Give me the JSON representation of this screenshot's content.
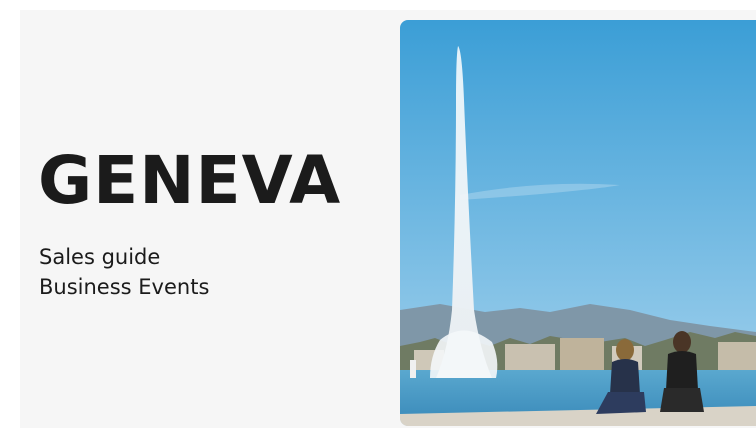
{
  "cover": {
    "title": "GENEVA",
    "subtitle_line1": "Sales guide",
    "subtitle_line2": "Business Events"
  },
  "photo": {
    "subject": "Jet d'Eau fountain over Lake Geneva with two people seated on the quay",
    "colors": {
      "sky_top": "#3b9ed6",
      "sky_bottom": "#9fd0ec",
      "lake": "#4f9fc7",
      "quay": "#d9d3c7"
    }
  },
  "colors": {
    "text": "#1b1b1b",
    "panel": "#f6f6f6"
  }
}
